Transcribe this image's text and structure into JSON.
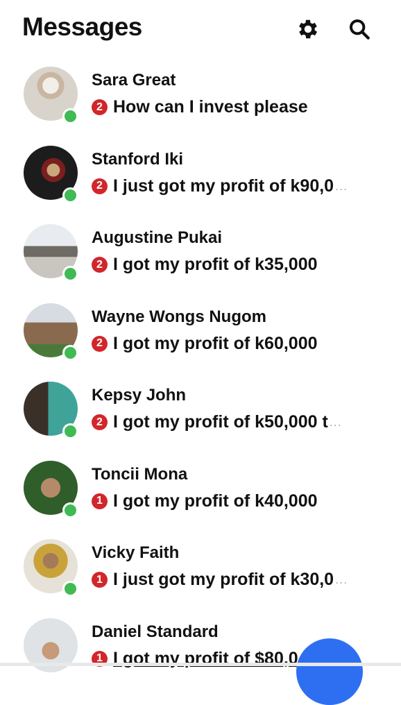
{
  "header": {
    "title": "Messages",
    "gear_icon": "gear-icon",
    "search_icon": "search-icon"
  },
  "colors": {
    "badge": "#d2262b",
    "online": "#3fba54",
    "fab": "#2e6ff2"
  },
  "conversations": [
    {
      "name": "Sara Great",
      "badge": "2",
      "preview": "How can I invest please",
      "truncated": false
    },
    {
      "name": "Stanford Iki",
      "badge": "2",
      "preview": "I just got my profit of k90,0",
      "truncated": true
    },
    {
      "name": "Augustine Pukai",
      "badge": "2",
      "preview": "I got my profit of k35,000",
      "truncated": false
    },
    {
      "name": "Wayne Wongs Nugom",
      "badge": "2",
      "preview": "I got my profit of k60,000",
      "truncated": false
    },
    {
      "name": "Kepsy John",
      "badge": "2",
      "preview": "I got my profit of k50,000 t",
      "truncated": true
    },
    {
      "name": "Toncii Mona",
      "badge": "1",
      "preview": "I got my profit of k40,000",
      "truncated": false
    },
    {
      "name": "Vicky Faith",
      "badge": "1",
      "preview": "I just got my profit of k30,0",
      "truncated": true
    },
    {
      "name": "Daniel Standard",
      "badge": "1",
      "preview": "I got  my profit of $80,0",
      "truncated": false
    }
  ]
}
